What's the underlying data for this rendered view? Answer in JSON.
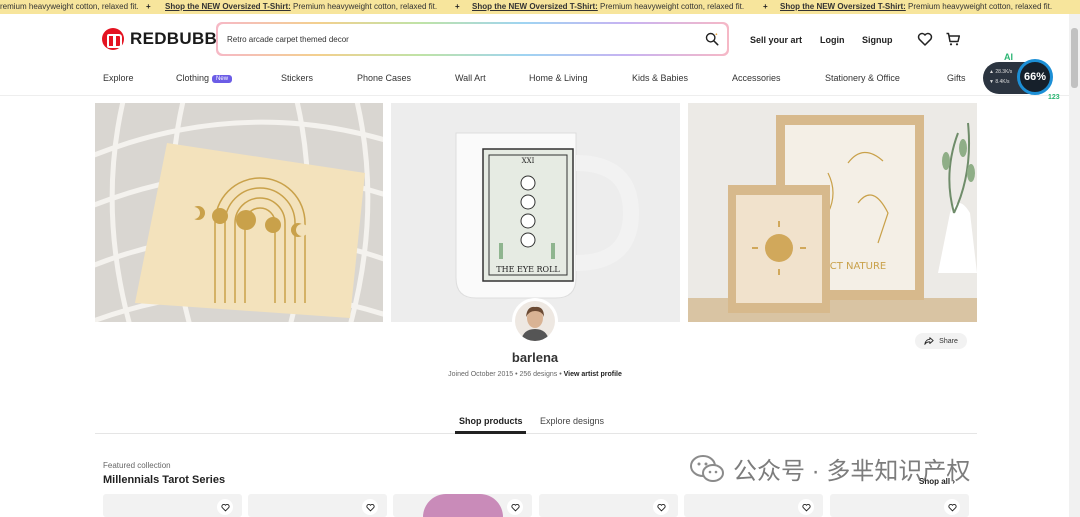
{
  "promo": {
    "segments": [
      {
        "prefix": "",
        "link": "",
        "text": "remium heavyweight cotton, relaxed fit."
      },
      {
        "prefix": "",
        "link": "Shop the NEW Oversized T-Shirt:",
        "text": " Premium heavyweight cotton, relaxed fit."
      },
      {
        "prefix": "",
        "link": "Shop the NEW Oversized T-Shirt:",
        "text": " Premium heavyweight cotton, relaxed fit."
      },
      {
        "prefix": "",
        "link": "Shop the NEW Oversized T-Shirt:",
        "text": " Premium heavyweight cotton, relaxed fit."
      }
    ],
    "separator": "+"
  },
  "header": {
    "logo_text": "REDBUBBLE",
    "search_value": "Retro arcade carpet themed decor",
    "sell_label": "Sell your art",
    "login_label": "Login",
    "signup_label": "Signup"
  },
  "nav": {
    "items": [
      "Explore",
      "Clothing",
      "Stickers",
      "Phone Cases",
      "Wall Art",
      "Home & Living",
      "Kids & Babies",
      "Accessories",
      "Stationery & Office",
      "Gifts"
    ],
    "clothing_badge": "New"
  },
  "ai_widget": {
    "label": "AI",
    "stat1": "28.3K/s",
    "stat2": "8.4K/s",
    "percent": "66%",
    "side_number": "123"
  },
  "hero": {
    "mug_card_title": "XXI",
    "mug_card_caption": "THE EYE ROLL",
    "print_text": "CT NATURE"
  },
  "artist": {
    "name": "barlena",
    "joined": "Joined October 2015",
    "designs": "256 designs",
    "profile_link": "View artist profile",
    "share_label": "Share"
  },
  "tabs": [
    {
      "label": "Shop products",
      "active": true
    },
    {
      "label": "Explore designs",
      "active": false
    }
  ],
  "featured": {
    "label": "Featured collection",
    "title": "Millennials Tarot Series",
    "shop_all": "Shop all"
  },
  "watermark": {
    "text": "公众号 · 多芈知识产权"
  },
  "colors": {
    "brand_red": "#e41321",
    "promo_bg": "#f7e59c",
    "new_badge": "#6b5ce6"
  }
}
